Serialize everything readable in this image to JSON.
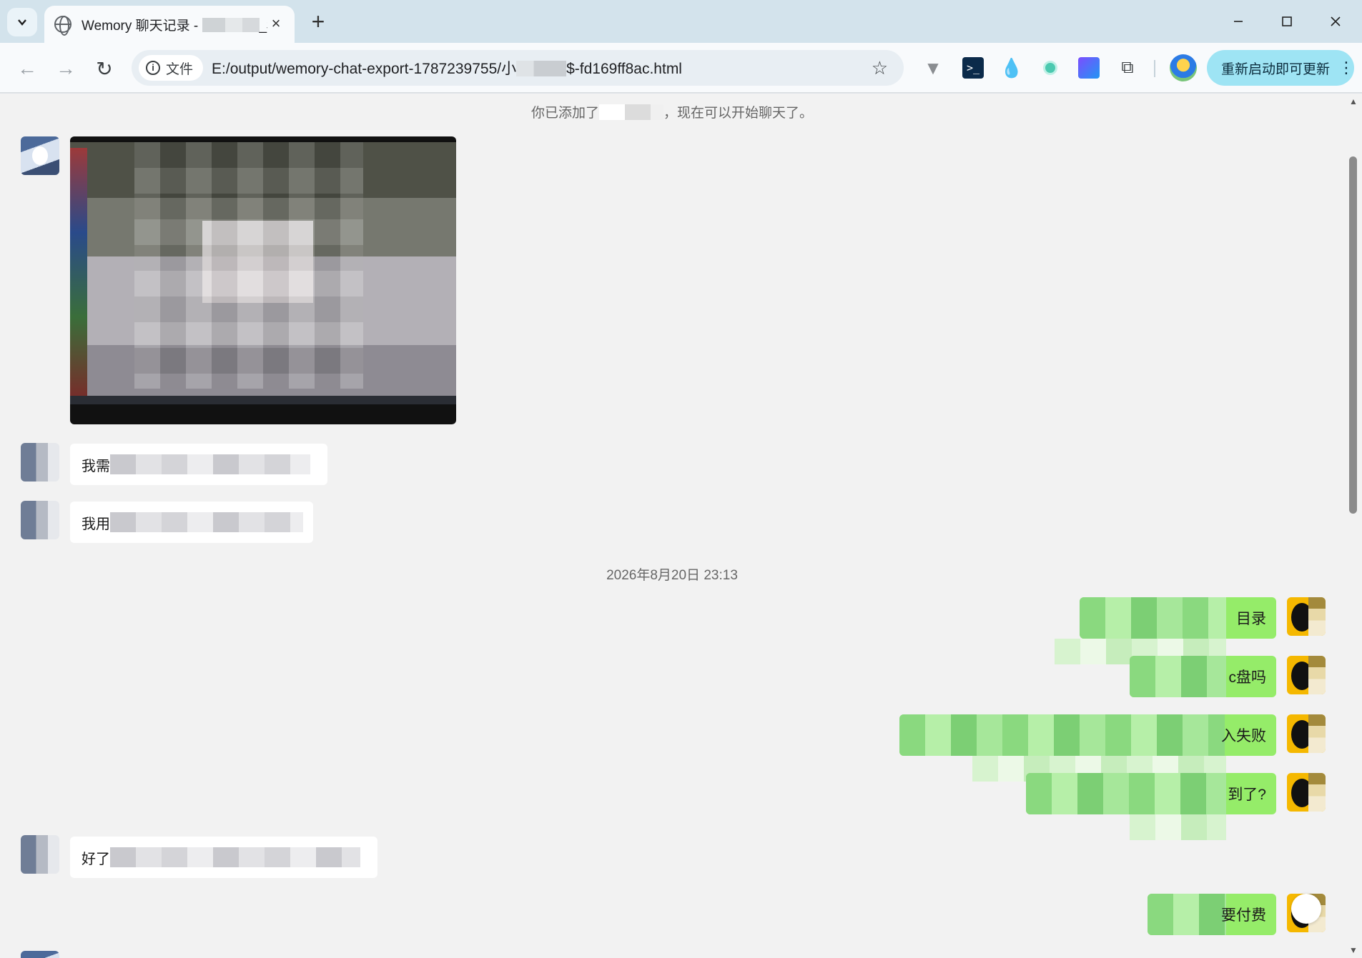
{
  "browser": {
    "tab": {
      "title_prefix": "Wemory 聊天记录 - ",
      "title_suffix": "_$"
    },
    "url": {
      "site_label": "文件",
      "prefix": "E:/output/wemory-chat-export-1787239755/小",
      "suffix": "$-fd169ff8ac.html"
    },
    "update_button": "重新启动即可更新"
  },
  "chat": {
    "system_notice": {
      "prefix": "你已添加了",
      "suffix": "，现在可以开始聊天了。"
    },
    "timestamp": "2026年8月20日 23:13",
    "incoming_messages": [
      {
        "visible_text": "我需"
      },
      {
        "visible_text": "我用"
      },
      {
        "visible_text": "好了"
      }
    ],
    "outgoing_messages": [
      {
        "visible_text": "目录"
      },
      {
        "visible_text": "c盘吗"
      },
      {
        "visible_text": "入失败"
      },
      {
        "visible_text": "到了?"
      },
      {
        "visible_text": "要付费"
      }
    ]
  }
}
